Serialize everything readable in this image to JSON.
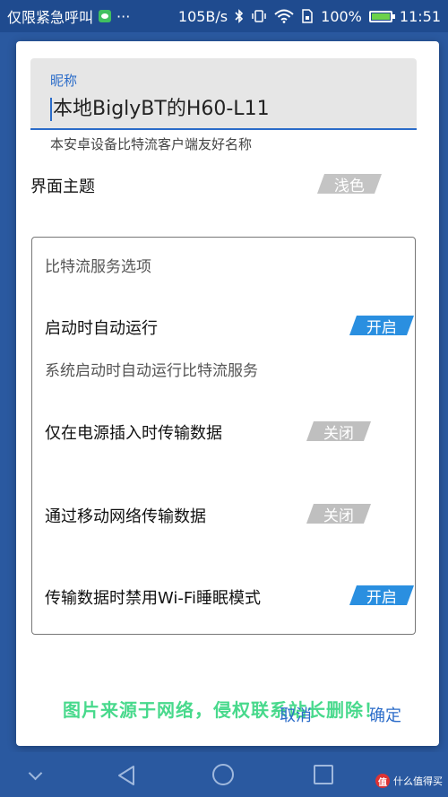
{
  "status_bar": {
    "left_text": "仅限紧急呼叫",
    "more": "···",
    "net_speed": "105B/s",
    "battery_pct": "100%",
    "time": "11:51",
    "icons": [
      "wechat-icon",
      "bluetooth-icon",
      "vibrate-icon",
      "wifi-icon",
      "sim-icon",
      "battery-icon"
    ]
  },
  "dialog": {
    "nickname": {
      "label": "昵称",
      "value": "本地BiglyBT的H60-L11",
      "help": "本安卓设备比特流客户端友好名称"
    },
    "theme": {
      "label": "界面主题",
      "value": "浅色"
    },
    "service_section": {
      "title": "比特流服务选项",
      "items": [
        {
          "label": "启动时自动运行",
          "state": "开启",
          "desc": "系统启动时自动运行比特流服务"
        },
        {
          "label": "仅在电源插入时传输数据",
          "state": "关闭"
        },
        {
          "label": "通过移动网络传输数据",
          "state": "关闭"
        },
        {
          "label": "传输数据时禁用Wi-Fi睡眠模式",
          "state": "开启"
        }
      ]
    },
    "actions": {
      "cancel": "取消",
      "ok": "确定"
    },
    "watermark": "图片来源于网络，侵权联系站长删除！"
  },
  "navbar": {
    "brand_text": "什么值得买",
    "brand_icon": "值"
  },
  "colors": {
    "accent": "#2b6cc9",
    "toggle_on": "#2a8fe0",
    "toggle_off": "#bfbfbf",
    "background": "#2a59a0"
  }
}
